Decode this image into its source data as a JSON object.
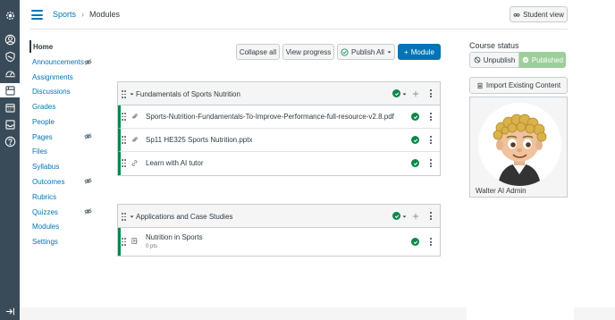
{
  "breadcrumb": {
    "course": "Sports",
    "separator": "›",
    "page": "Modules"
  },
  "header": {
    "student_view_label": "Student view"
  },
  "course_nav": [
    {
      "label": "Home",
      "hidden": false
    },
    {
      "label": "Announcements",
      "hidden": true
    },
    {
      "label": "Assignments",
      "hidden": false
    },
    {
      "label": "Discussions",
      "hidden": false
    },
    {
      "label": "Grades",
      "hidden": false
    },
    {
      "label": "People",
      "hidden": false
    },
    {
      "label": "Pages",
      "hidden": true
    },
    {
      "label": "Files",
      "hidden": false
    },
    {
      "label": "Syllabus",
      "hidden": false
    },
    {
      "label": "Outcomes",
      "hidden": true
    },
    {
      "label": "Rubrics",
      "hidden": false
    },
    {
      "label": "Quizzes",
      "hidden": true
    },
    {
      "label": "Modules",
      "hidden": false
    },
    {
      "label": "Settings",
      "hidden": false
    }
  ],
  "toolbar": {
    "collapse_all": "Collapse all",
    "view_progress": "View progress",
    "publish_all": "Publish All",
    "add_module": "Module",
    "add_module_prefix": "+"
  },
  "modules": [
    {
      "title": "Fundamentals of Sports Nutrition",
      "items": [
        {
          "title": "Sports-Nutrition-Fundamentals-To-Improve-Performance-full-resource-v2.8.pdf",
          "icon": "attachment-icon",
          "sub": ""
        },
        {
          "title": "Sp11 HE325 Sports Nutrition.pptx",
          "icon": "attachment-icon",
          "sub": ""
        },
        {
          "title": "Learn with AI tutor",
          "icon": "link-icon",
          "sub": ""
        }
      ]
    },
    {
      "title": "Applications and Case Studies",
      "items": [
        {
          "title": "Nutrition in Sports",
          "icon": "quiz-icon",
          "sub": "0 pts"
        }
      ]
    }
  ],
  "sidebar": {
    "course_status_label": "Course status",
    "unpublish_label": "Unpublish",
    "published_label": "Published",
    "import_label": "Import Existing Content",
    "agent_name": "Walter AI Admin"
  },
  "colors": {
    "nav_bg": "#394b58",
    "brand_blue": "#0374b5",
    "published_green": "#0b874b",
    "published_button": "#9ccf9a"
  }
}
